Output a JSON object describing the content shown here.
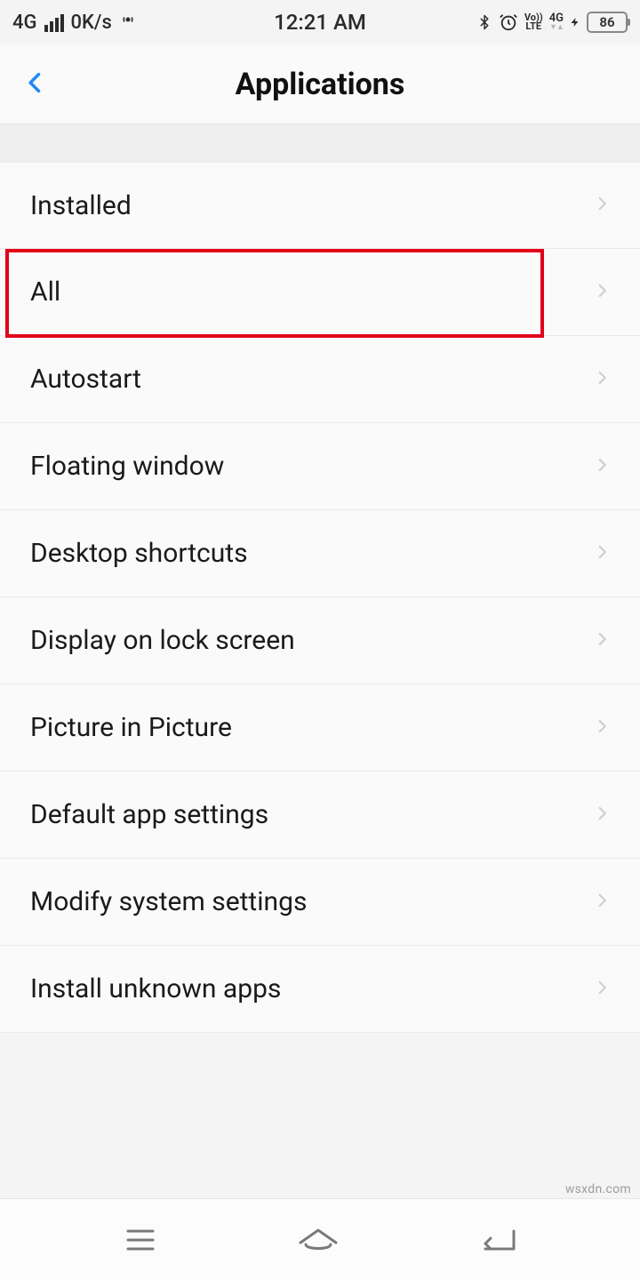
{
  "statusbar": {
    "network_type": "4G",
    "data_speed": "0K/s",
    "time": "12:21 AM",
    "volte_top": "Vo))",
    "volte_bottom": "LTE",
    "secondary_net": "4G",
    "battery_level": "86"
  },
  "header": {
    "title": "Applications"
  },
  "items": [
    {
      "label": "Installed"
    },
    {
      "label": "All"
    },
    {
      "label": "Autostart"
    },
    {
      "label": "Floating window"
    },
    {
      "label": "Desktop shortcuts"
    },
    {
      "label": "Display on lock screen"
    },
    {
      "label": "Picture in Picture"
    },
    {
      "label": "Default app settings"
    },
    {
      "label": "Modify system settings"
    },
    {
      "label": "Install unknown apps"
    }
  ],
  "highlighted_index": 1,
  "watermark": "wsxdn.com"
}
